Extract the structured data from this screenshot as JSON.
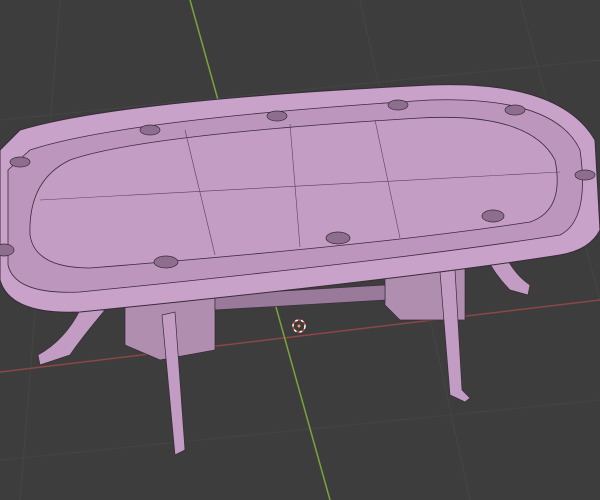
{
  "viewport": {
    "background": "#3d3d3d",
    "grid_color": "#4a4a4a",
    "x_axis_color": "#9a4a4a",
    "y_axis_color": "#7aa43a",
    "mesh_color": "#c9a2c9",
    "mesh_dark": "#a882a8",
    "wire_color": "#3a2a3a",
    "object": "poker-table"
  }
}
